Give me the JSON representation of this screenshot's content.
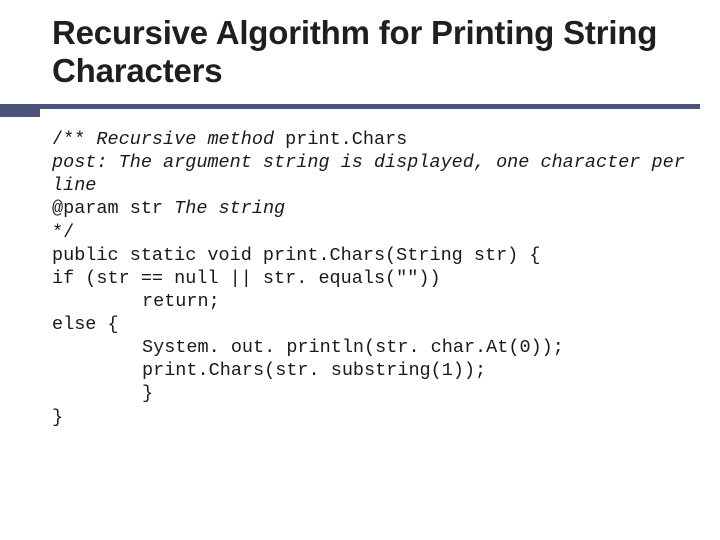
{
  "title": "Recursive Algorithm for Printing String Characters",
  "code": {
    "c1a": "/** ",
    "c1b": "Recursive method",
    "c1c": " print.Chars",
    "c2": "post: The argument string is displayed, one character per line",
    "c3a": "@param ",
    "c3b": "str ",
    "c3c": "The string",
    "c4": "*/",
    "c5": "public static void print.Chars(String str) {",
    "c6": "if (str == null || str. equals(\"\"))",
    "c7": "return;",
    "c8": "else {",
    "c9": "System. out. println(str. char.At(0));",
    "c10": "print.Chars(str. substring(1));",
    "c11": "}",
    "c12": "}"
  }
}
